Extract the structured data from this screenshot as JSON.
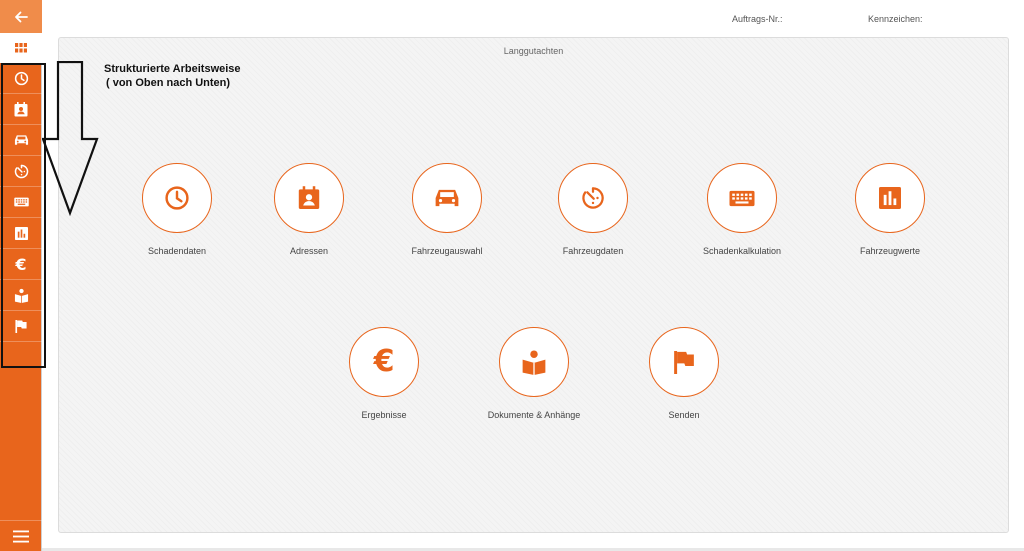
{
  "colors": {
    "accent": "#e8651c",
    "accent_light": "#f08c4a",
    "panel_bg": "#f4f4f4"
  },
  "topbar": {
    "order_label": "Auftrags-Nr.:",
    "plate_label": "Kennzeichen:"
  },
  "panel": {
    "title": "Langgutachten"
  },
  "annotation": {
    "line1": "Strukturierte Arbeitsweise",
    "line2": "( von Oben nach Unten)"
  },
  "sidebar": {
    "back_icon": "arrow-left-icon",
    "grid_icon": "grid-icon",
    "menu_icon": "hamburger-icon",
    "items": [
      {
        "icon": "clock-icon"
      },
      {
        "icon": "contact-card-icon"
      },
      {
        "icon": "car-icon"
      },
      {
        "icon": "timer-icon"
      },
      {
        "icon": "keyboard-icon"
      },
      {
        "icon": "bar-chart-icon"
      },
      {
        "icon": "euro-icon"
      },
      {
        "icon": "reader-icon"
      },
      {
        "icon": "flag-icon"
      }
    ]
  },
  "tiles": [
    {
      "label": "Schadendaten",
      "icon": "clock-icon"
    },
    {
      "label": "Adressen",
      "icon": "contact-card-icon"
    },
    {
      "label": "Fahrzeugauswahl",
      "icon": "car-icon"
    },
    {
      "label": "Fahrzeugdaten",
      "icon": "timer-icon"
    },
    {
      "label": "Schadenkalkulation",
      "icon": "keyboard-icon"
    },
    {
      "label": "Fahrzeugwerte",
      "icon": "bar-chart-icon"
    },
    {
      "label": "Ergebnisse",
      "icon": "euro-icon"
    },
    {
      "label": "Dokumente & Anhänge",
      "icon": "reader-icon"
    },
    {
      "label": "Senden",
      "icon": "flag-icon"
    }
  ]
}
